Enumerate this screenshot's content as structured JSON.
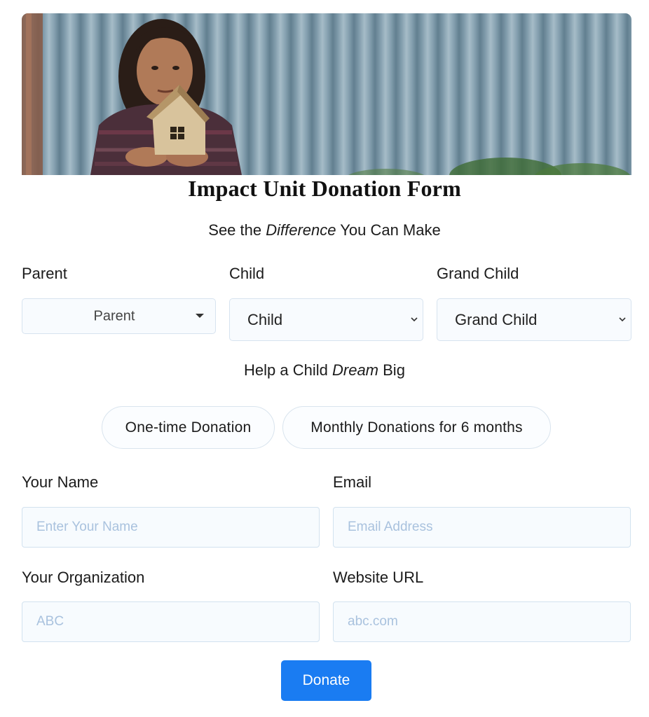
{
  "form": {
    "title": "Impact Unit Donation Form",
    "subtitle_prefix": "See the ",
    "subtitle_emphasis": "Difference",
    "subtitle_suffix": " You Can Make",
    "help_prefix": "Help a Child ",
    "help_emphasis": "Dream",
    "help_suffix": " Big"
  },
  "selectors": {
    "parent": {
      "label": "Parent",
      "value": "Parent",
      "icon": "caret-down-icon"
    },
    "child": {
      "label": "Child",
      "value": "Child",
      "icon": "chevron-down-icon"
    },
    "grand_child": {
      "label": "Grand Child",
      "value": "Grand Child",
      "icon": "chevron-down-icon"
    }
  },
  "donation_types": {
    "one_time": "One-time Donation",
    "monthly": "Monthly Donations for 6 months"
  },
  "fields": {
    "name": {
      "label": "Your Name",
      "placeholder": "Enter Your Name",
      "value": ""
    },
    "email": {
      "label": "Email",
      "placeholder": "Email Address",
      "value": ""
    },
    "organization": {
      "label": "Your Organization",
      "placeholder": "ABC",
      "value": ""
    },
    "website": {
      "label": "Website URL",
      "placeholder": "abc.com",
      "value": ""
    }
  },
  "actions": {
    "donate_label": "Donate"
  },
  "colors": {
    "accent": "#1a7cf2",
    "input_bg": "#f7fbfe",
    "placeholder": "#a9c2de"
  }
}
